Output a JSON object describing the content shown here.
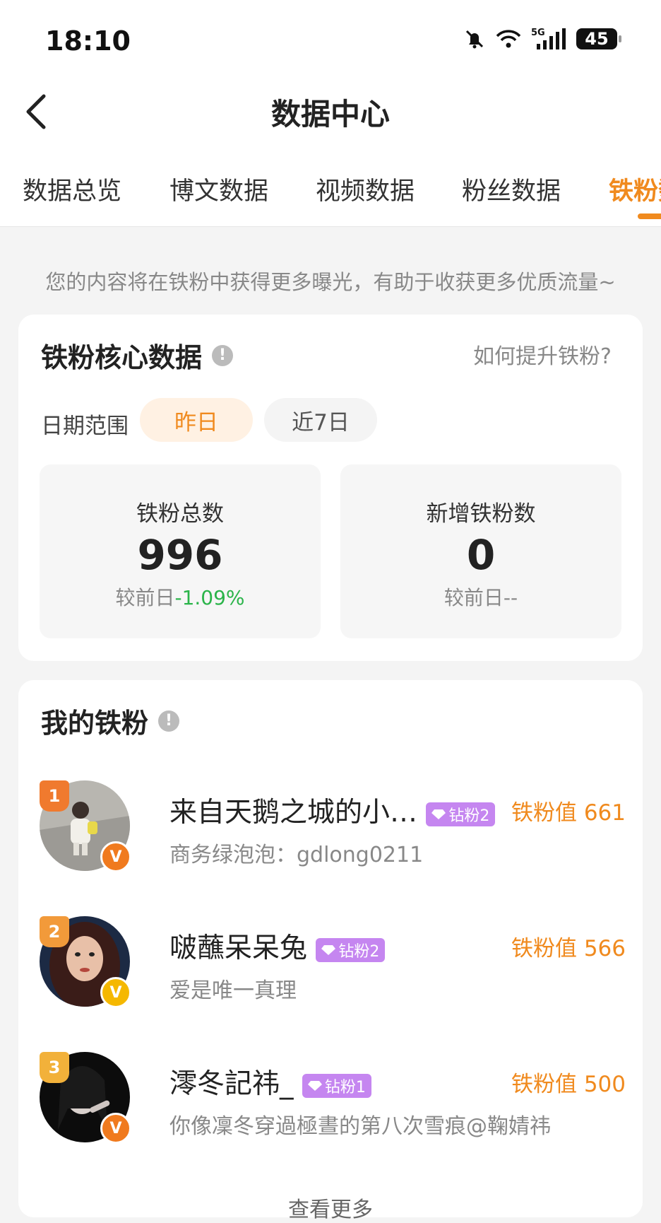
{
  "status_bar": {
    "time": "18:10",
    "battery": "45"
  },
  "header": {
    "title": "数据中心"
  },
  "tabs": [
    {
      "label": "数据总览"
    },
    {
      "label": "博文数据"
    },
    {
      "label": "视频数据"
    },
    {
      "label": "粉丝数据"
    },
    {
      "label": "铁粉数据",
      "active": true
    }
  ],
  "notice": "您的内容将在铁粉中获得更多曝光，有助于收获更多优质流量~",
  "core": {
    "title": "铁粉核心数据",
    "help_link": "如何提升铁粉?",
    "date_label": "日期范围",
    "date_options": [
      "昨日",
      "近7日"
    ],
    "selected_date": "昨日",
    "stats": [
      {
        "label": "铁粉总数",
        "value": "996",
        "compare_prefix": "较前日",
        "compare_value": "-1.09%"
      },
      {
        "label": "新增铁粉数",
        "value": "0",
        "compare_prefix": "较前日",
        "compare_value": "--"
      }
    ]
  },
  "my_fans": {
    "title": "我的铁粉",
    "list": [
      {
        "rank": "1",
        "name": "来自天鹅之城的小…",
        "level": "钻粉2",
        "value_label": "铁粉值 661",
        "bio": "商务绿泡泡：gdlong0211",
        "badge_letter": "V"
      },
      {
        "rank": "2",
        "name": "啵蘸呆呆兔",
        "level": "钻粉2",
        "value_label": "铁粉值 566",
        "bio": "爱是唯一真理",
        "badge_letter": "V"
      },
      {
        "rank": "3",
        "name": "澪冬記祎_",
        "level": "钻粉1",
        "value_label": "铁粉值 500",
        "bio": "你像凜冬穿過極晝的第八次雪痕@鞠婧祎",
        "badge_letter": "V"
      }
    ],
    "more_label": "查看更多"
  },
  "colors": {
    "accent": "#f08a1e",
    "negative": "#2bb44a",
    "level_badge": "#c586f0"
  }
}
